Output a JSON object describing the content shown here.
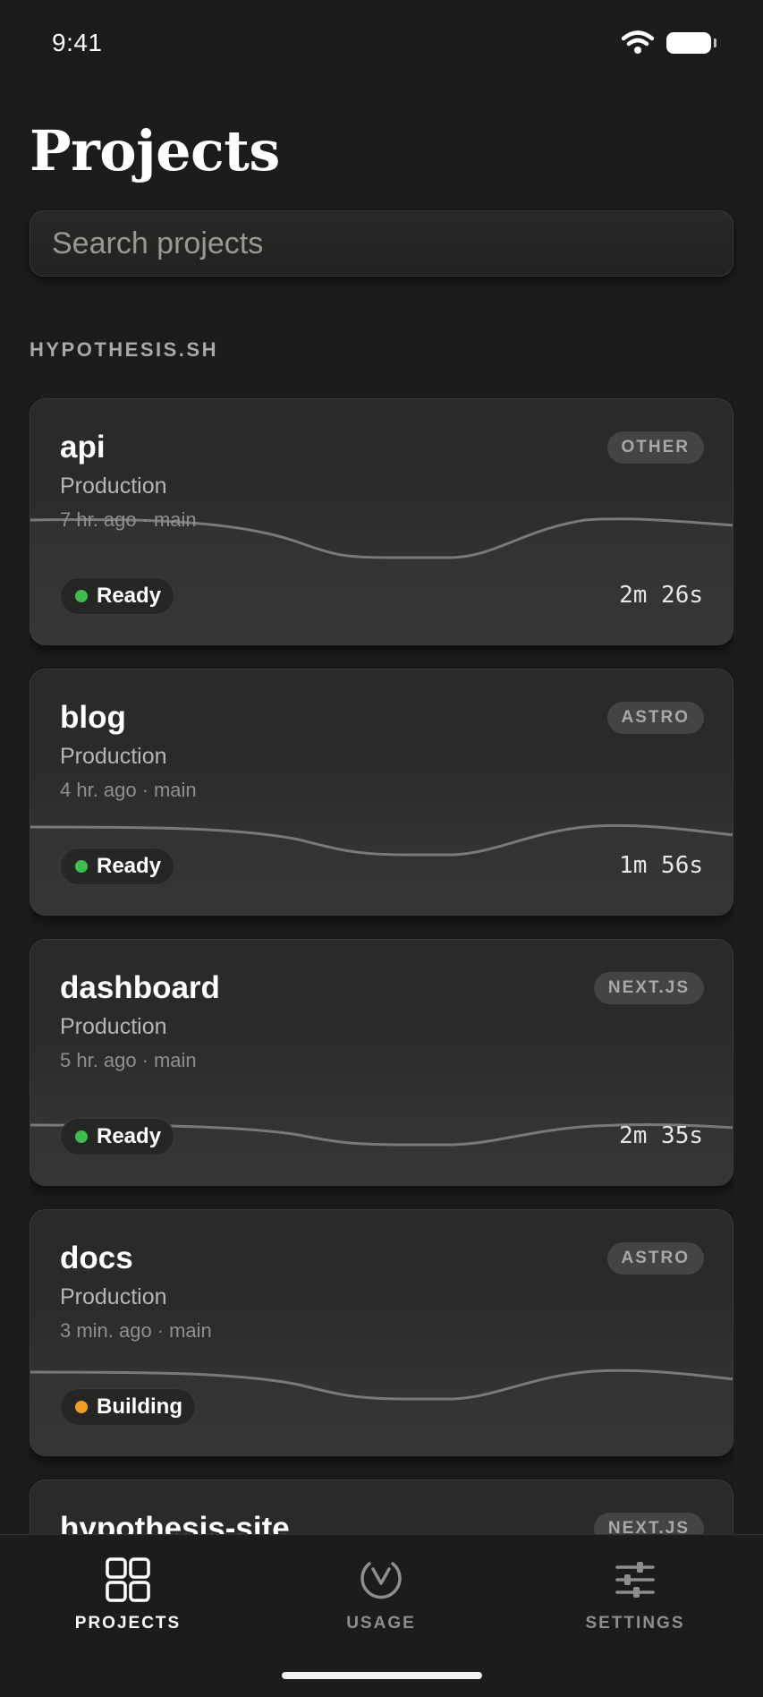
{
  "status_bar": {
    "time": "9:41"
  },
  "page": {
    "title": "Projects"
  },
  "search": {
    "placeholder": "Search projects",
    "value": ""
  },
  "section": {
    "label": "HYPOTHESIS.SH"
  },
  "colors": {
    "ready": "#3cbf4f",
    "building": "#f0a020",
    "background": "#1c1c1c"
  },
  "projects": [
    {
      "name": "api",
      "framework": "OTHER",
      "environment": "Production",
      "time_ago": "7 hr. ago",
      "branch": "main",
      "status": "Ready",
      "status_color": "#3cbf4f",
      "duration": "2m 26s"
    },
    {
      "name": "blog",
      "framework": "ASTRO",
      "environment": "Production",
      "time_ago": "4 hr. ago",
      "branch": "main",
      "status": "Ready",
      "status_color": "#3cbf4f",
      "duration": "1m 56s"
    },
    {
      "name": "dashboard",
      "framework": "NEXT.JS",
      "environment": "Production",
      "time_ago": "5 hr. ago",
      "branch": "main",
      "status": "Ready",
      "status_color": "#3cbf4f",
      "duration": "2m 35s"
    },
    {
      "name": "docs",
      "framework": "ASTRO",
      "environment": "Production",
      "time_ago": "3 min. ago",
      "branch": "main",
      "status": "Building",
      "status_color": "#f0a020",
      "duration": ""
    },
    {
      "name": "hypothesis-site",
      "framework": "NEXT.JS",
      "environment": "",
      "time_ago": "",
      "branch": "",
      "status": "",
      "status_color": "",
      "duration": ""
    }
  ],
  "tabs": [
    {
      "label": "PROJECTS",
      "icon": "grid-icon",
      "active": true
    },
    {
      "label": "USAGE",
      "icon": "gauge-icon",
      "active": false
    },
    {
      "label": "SETTINGS",
      "icon": "sliders-icon",
      "active": false
    }
  ]
}
